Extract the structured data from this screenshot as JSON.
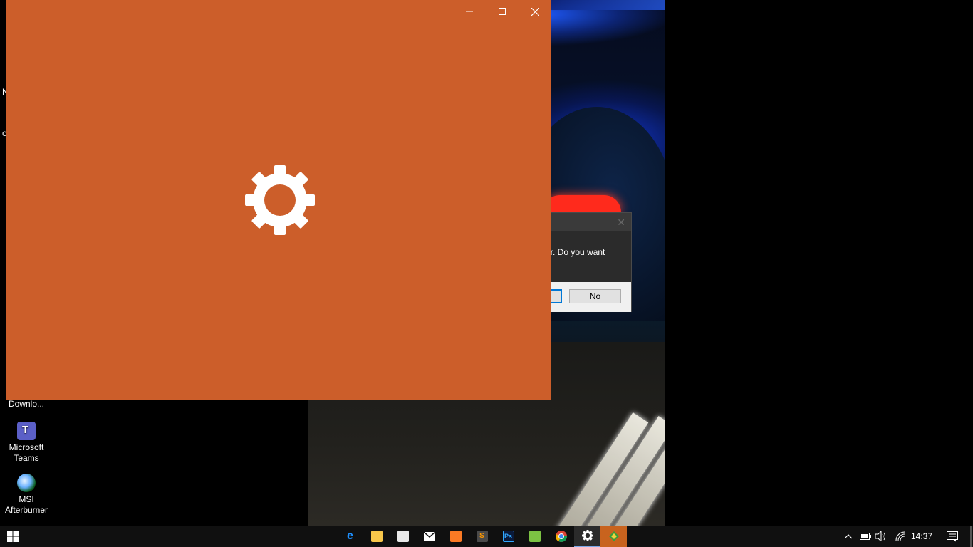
{
  "desktop": {
    "icons": [
      {
        "label": "Downlo..."
      },
      {
        "label": "Microsoft Teams"
      },
      {
        "label": "MSI Afterburner"
      }
    ],
    "edge_peek": [
      "N",
      "c"
    ]
  },
  "dialog": {
    "message_fragment": "er. Do you want",
    "no_label": "No"
  },
  "settings_window": {
    "background_color": "#cc5e2a",
    "splash_icon": "gear-icon"
  },
  "taskbar": {
    "apps": [
      {
        "name": "edge",
        "icon": "edge-icon"
      },
      {
        "name": "file-explorer",
        "icon": "folder-icon"
      },
      {
        "name": "store",
        "icon": "store-icon"
      },
      {
        "name": "mail",
        "icon": "mail-icon"
      },
      {
        "name": "xampp",
        "icon": "xampp-icon"
      },
      {
        "name": "sublime-text",
        "icon": "sublime-icon"
      },
      {
        "name": "photoshop",
        "icon": "photoshop-icon",
        "glyph": "Ps"
      },
      {
        "name": "notepad-plus",
        "icon": "notepad-icon"
      },
      {
        "name": "chrome",
        "icon": "chrome-icon"
      },
      {
        "name": "settings",
        "icon": "gear-icon",
        "active": true
      },
      {
        "name": "app-highlighted",
        "icon": "app-icon",
        "highlight": true
      }
    ],
    "tray": {
      "time": "14:37"
    }
  }
}
